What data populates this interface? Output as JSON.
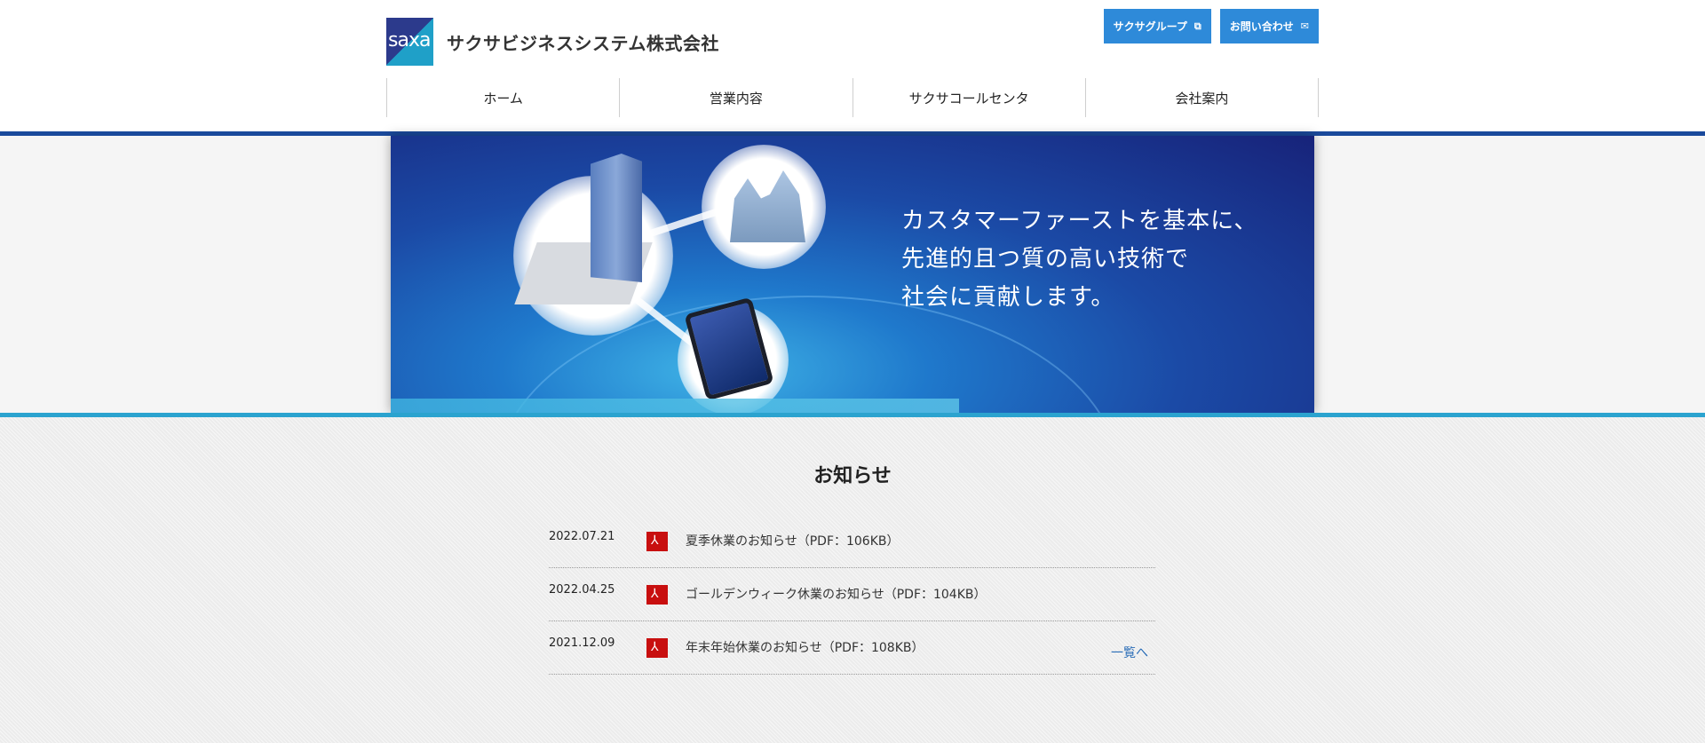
{
  "header": {
    "logo_mark": "saxa",
    "company_name": "サクサビジネスシステム株式会社",
    "top_buttons": [
      {
        "label": "サクサグループ",
        "icon": "external-link-icon"
      },
      {
        "label": "お問い合わせ",
        "icon": "envelope-icon"
      }
    ],
    "nav": [
      {
        "label": "ホーム"
      },
      {
        "label": "営業内容"
      },
      {
        "label": "サクサコールセンタ"
      },
      {
        "label": "会社案内"
      }
    ]
  },
  "hero": {
    "line1": "カスタマーファーストを基本に、",
    "line2": "先進的且つ質の高い技術で",
    "line3": "社会に貢献します。"
  },
  "news": {
    "title": "お知らせ",
    "items": [
      {
        "date": "2022.07.21",
        "text": "夏季休業のお知らせ（PDF：106KB）",
        "icon": "pdf-icon"
      },
      {
        "date": "2022.04.25",
        "text": "ゴールデンウィーク休業のお知らせ（PDF：104KB）",
        "icon": "pdf-icon"
      },
      {
        "date": "2021.12.09",
        "text": "年末年始休業のお知らせ（PDF：108KB）",
        "icon": "pdf-icon"
      }
    ],
    "more_label": "一覧へ"
  },
  "colors": {
    "brand_blue": "#2e8ad9",
    "header_rule": "#1a4a9c",
    "hero_rule": "#2ba3cf",
    "pdf_red": "#c80f0f",
    "link": "#2a6db7"
  }
}
